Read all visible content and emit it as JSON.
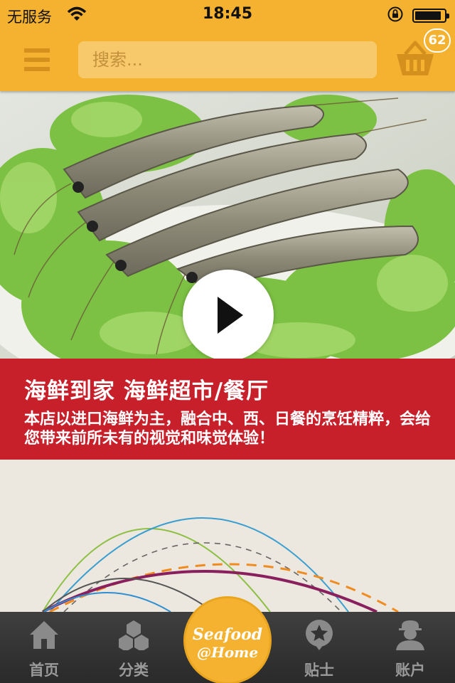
{
  "status_bar": {
    "carrier": "无服务",
    "time": "18:45"
  },
  "header": {
    "search_placeholder": "搜索...",
    "cart_count": "62",
    "colors": {
      "bar": "#f5b230",
      "search_bg": "#f8c96a",
      "icon": "#d4901d"
    }
  },
  "hero": {
    "image": "shrimp-on-lettuce-photo",
    "play_icon": "play-icon"
  },
  "banner": {
    "title": "海鲜到家 海鲜超市/餐厅",
    "description": "本店以进口海鲜为主，融合中、西、日餐的烹饪精粹，会给您带来前所未有的视觉和味觉体验！",
    "color": "#c8202b"
  },
  "tabbar": {
    "tabs": [
      {
        "label": "首页",
        "icon": "home-icon"
      },
      {
        "label": "分类",
        "icon": "category-icon"
      },
      {
        "label": "贴士",
        "icon": "tips-icon"
      },
      {
        "label": "账户",
        "icon": "account-icon"
      }
    ],
    "center_logo": {
      "line1": "Seafood",
      "line2": "@Home"
    }
  }
}
